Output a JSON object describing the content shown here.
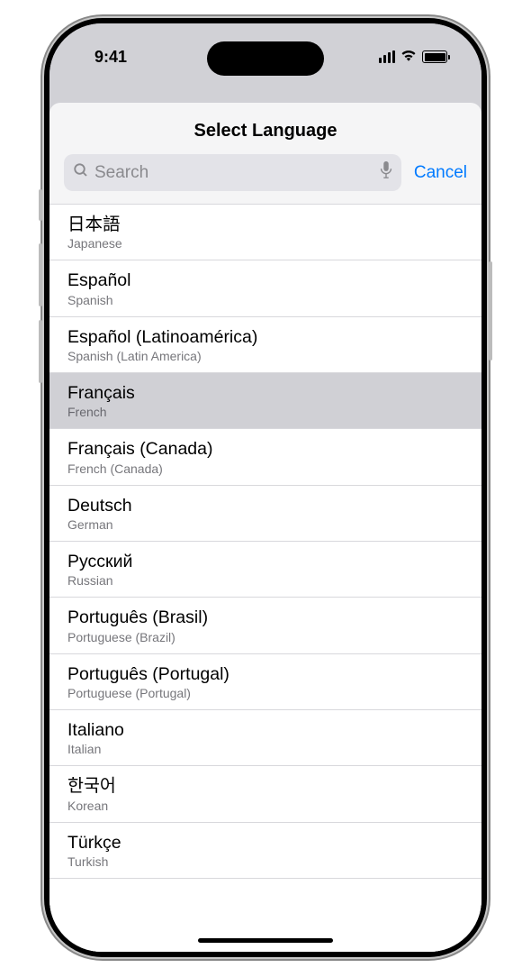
{
  "status": {
    "time": "9:41"
  },
  "header": {
    "title": "Select Language"
  },
  "search": {
    "placeholder": "Search",
    "cancel_label": "Cancel"
  },
  "languages": [
    {
      "native": "日本語",
      "english": "Japanese",
      "selected": false
    },
    {
      "native": "Español",
      "english": "Spanish",
      "selected": false
    },
    {
      "native": "Español (Latinoamérica)",
      "english": "Spanish (Latin America)",
      "selected": false
    },
    {
      "native": "Français",
      "english": "French",
      "selected": true
    },
    {
      "native": "Français (Canada)",
      "english": "French (Canada)",
      "selected": false
    },
    {
      "native": "Deutsch",
      "english": "German",
      "selected": false
    },
    {
      "native": "Русский",
      "english": "Russian",
      "selected": false
    },
    {
      "native": "Português (Brasil)",
      "english": "Portuguese (Brazil)",
      "selected": false
    },
    {
      "native": "Português (Portugal)",
      "english": "Portuguese (Portugal)",
      "selected": false
    },
    {
      "native": "Italiano",
      "english": "Italian",
      "selected": false
    },
    {
      "native": "한국어",
      "english": "Korean",
      "selected": false
    },
    {
      "native": "Türkçe",
      "english": "Turkish",
      "selected": false
    }
  ]
}
